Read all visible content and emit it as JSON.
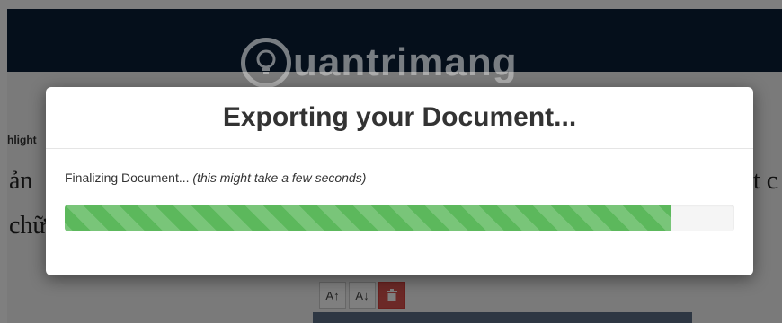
{
  "background": {
    "highlight_label": "hlight",
    "left_line1": "ản",
    "left_line2": "chữ",
    "right_line1": "t c",
    "toolbar": {
      "increase_label": "A↑",
      "decrease_label": "A↓"
    }
  },
  "watermark": {
    "text": "uantrimang"
  },
  "modal": {
    "title": "Exporting your Document...",
    "status_text": "Finalizing Document...",
    "status_note": "(this might take a few seconds)",
    "progress_percent": 90.5,
    "progress_color": "#5cb85c"
  }
}
